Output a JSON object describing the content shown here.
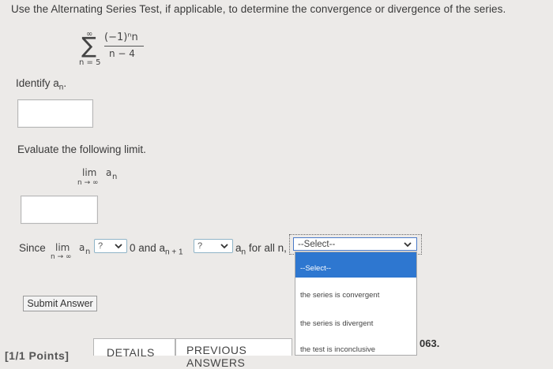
{
  "question": {
    "prompt": "Use the Alternating Series Test, if applicable, to determine the convergence or divergence of the series.",
    "series": {
      "sum_symbol": "∑",
      "upper": "∞",
      "lower": "n = 5",
      "numerator": "(−1)ⁿn",
      "denominator": "n − 4"
    },
    "identify_label": "Identify a",
    "identify_sub": "n",
    "identify_suffix": ".",
    "evaluate_label": "Evaluate the following limit.",
    "limit": {
      "lim": "lim",
      "below": "n → ∞",
      "expr": "a",
      "sub": "n"
    },
    "since": {
      "since_word": "Since",
      "lim": "lim",
      "below": "n → ∞",
      "a": "a",
      "sub_n": "n",
      "compare1_value": "?",
      "zero_and": "0 and a",
      "sub_n1": "n + 1",
      "compare2_value": "?",
      "a2": "a",
      "sub_n2": "n",
      "for_all": "for all n,"
    }
  },
  "dropdown": {
    "selected": "--Select--",
    "options": [
      "--Select--",
      "the series is convergent",
      "the series is divergent",
      "the test is inconclusive"
    ]
  },
  "buttons": {
    "submit": "Submit Answer"
  },
  "footer": {
    "points": "[1/1 Points]",
    "details": "DETAILS",
    "previous": "PREVIOUS ANSWERS",
    "code": "063."
  },
  "colors": {
    "highlight": "#2e77d0",
    "background": "#eceae8"
  }
}
